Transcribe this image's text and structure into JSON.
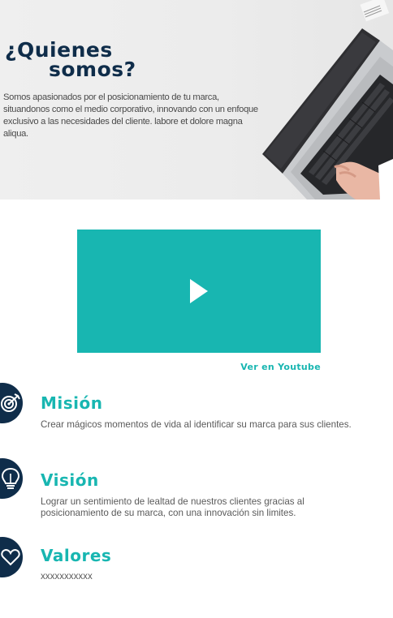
{
  "hero": {
    "title_line1": "¿Quienes",
    "title_line2": "somos?",
    "description": "Somos apasionados por el posicionamiento de tu marca, situandonos como el medio corporativo, innovando con un enfoque exclusivo  a las necesidades del cliente. labore et dolore magna aliqua."
  },
  "video": {
    "link_label": "Ver en Youtube"
  },
  "items": [
    {
      "title": "Misión",
      "text": "Crear mágicos momentos de vida al identificar su marca para sus clientes.",
      "icon": "target-icon"
    },
    {
      "title": "Visión",
      "text": "Lograr un sentimiento de lealtad de nuestros clientes gracias al posicionamiento de su marca, con una innovación sin limites.",
      "icon": "lightbulb-icon"
    },
    {
      "title": "Valores",
      "text": "xxxxxxxxxxx",
      "icon": "heart-icon"
    }
  ],
  "colors": {
    "accent": "#18b6b1",
    "navy": "#0f2d4a"
  }
}
